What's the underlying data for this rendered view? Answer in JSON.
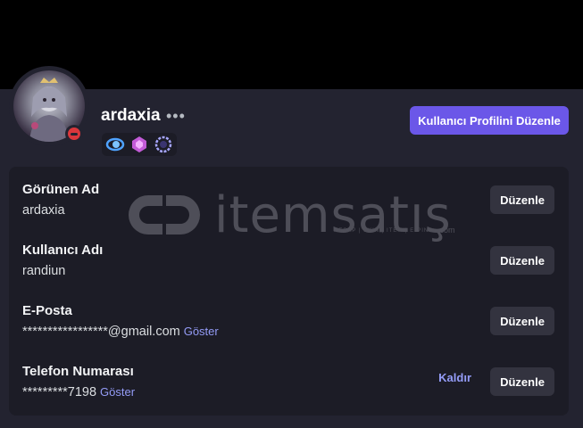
{
  "profile": {
    "username": "ardaxia",
    "more_icon": "ellipsis-icon",
    "status": "do-not-disturb",
    "status_color": "#da373c",
    "badges": [
      "nitro-orbit-badge",
      "boost-gem-badge",
      "laurel-quest-badge"
    ],
    "edit_profile_label": "Kullanıcı Profilini Düzenle",
    "accent_color": "#6b57e8"
  },
  "fields": {
    "display_name": {
      "label": "Görünen Ad",
      "value": "ardaxia",
      "edit_label": "Düzenle"
    },
    "username": {
      "label": "Kullanıcı Adı",
      "value": "randiun",
      "edit_label": "Düzenle"
    },
    "email": {
      "label": "E-Posta",
      "value": "*****************@gmail.com",
      "reveal_label": "Göster",
      "edit_label": "Düzenle"
    },
    "phone": {
      "label": "Telefon Numarası",
      "value": "*********7198",
      "reveal_label": "Göster",
      "remove_label": "Kaldır",
      "edit_label": "Düzenle"
    }
  },
  "watermark": {
    "brand": "itemsatış",
    "tagline": "HESAP | SKIN | ITEM | E-PIN",
    "domain": ".com"
  }
}
